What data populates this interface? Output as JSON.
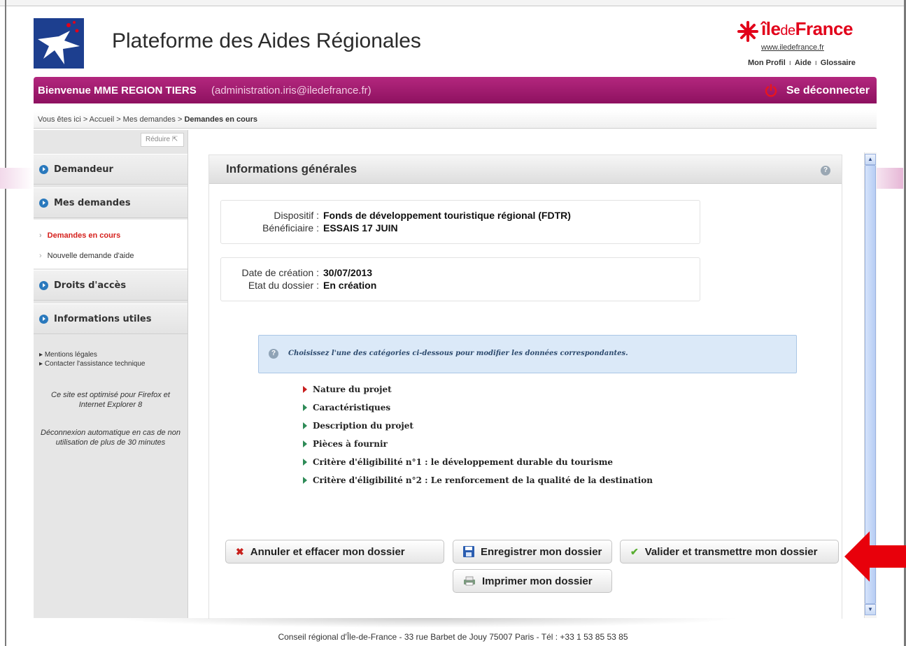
{
  "header": {
    "site_title": "Plateforme des Aides Régionales",
    "brand": {
      "ile": "île",
      "de": "de",
      "france": "France",
      "url": "www.iledefrance.fr"
    },
    "links": [
      "Mon Profil",
      "Aide",
      "Glossaire"
    ]
  },
  "welcome": {
    "name": "Bienvenue MME REGION TIERS",
    "email": "(administration.iris@iledefrance.fr)",
    "logout": "Se déconnecter"
  },
  "breadcrumb": {
    "prefix": "Vous êtes ici > Accueil > Mes demandes > ",
    "current": "Demandes en cours"
  },
  "sidebar": {
    "reduce": "Réduire",
    "menu": [
      "Demandeur",
      "Mes demandes",
      "Droits d'accès",
      "Informations utiles"
    ],
    "submenu": [
      "Demandes en cours",
      "Nouvelle demande d'aide"
    ],
    "links": [
      "Mentions légales",
      "Contacter l'assistance technique"
    ],
    "note1": "Ce site est optimisé pour Firefox et Internet Explorer 8",
    "note2": "Déconnexion automatique en cas de non utilisation de plus de 30 minutes"
  },
  "panel": {
    "title": "Informations générales",
    "dispositif_label": "Dispositif :",
    "dispositif_value": "Fonds de développement touristique régional (FDTR)",
    "beneficiaire_label": "Bénéficiaire :",
    "beneficiaire_value": "ESSAIS 17 JUIN",
    "date_label": "Date de création :",
    "date_value": "30/07/2013",
    "etat_label": "Etat du dossier :",
    "etat_value": "En création",
    "tip": "Choisissez l'une des catégories ci-dessous pour modifier les données correspondantes.",
    "categories": [
      "Nature du projet",
      "Caractéristiques",
      "Description du projet",
      "Pièces à fournir",
      "Critère d'éligibilité n°1 : le développement durable du tourisme",
      "Critère d'éligibilité n°2 : Le renforcement de la qualité de la destination"
    ]
  },
  "buttons": {
    "cancel": "Annuler et effacer mon dossier",
    "save": "Enregistrer mon dossier",
    "validate": "Valider et transmettre mon dossier",
    "print": "Imprimer mon dossier"
  },
  "footer": "Conseil régional d'Île-de-France - 33 rue Barbet de Jouy 75007 Paris - Tél : +33 1 53 85 53 85",
  "colors": {
    "accent": "#9e1a6e",
    "brand_red": "#e2001a",
    "link_active": "#d5201c",
    "arrow": "#e8000b"
  }
}
